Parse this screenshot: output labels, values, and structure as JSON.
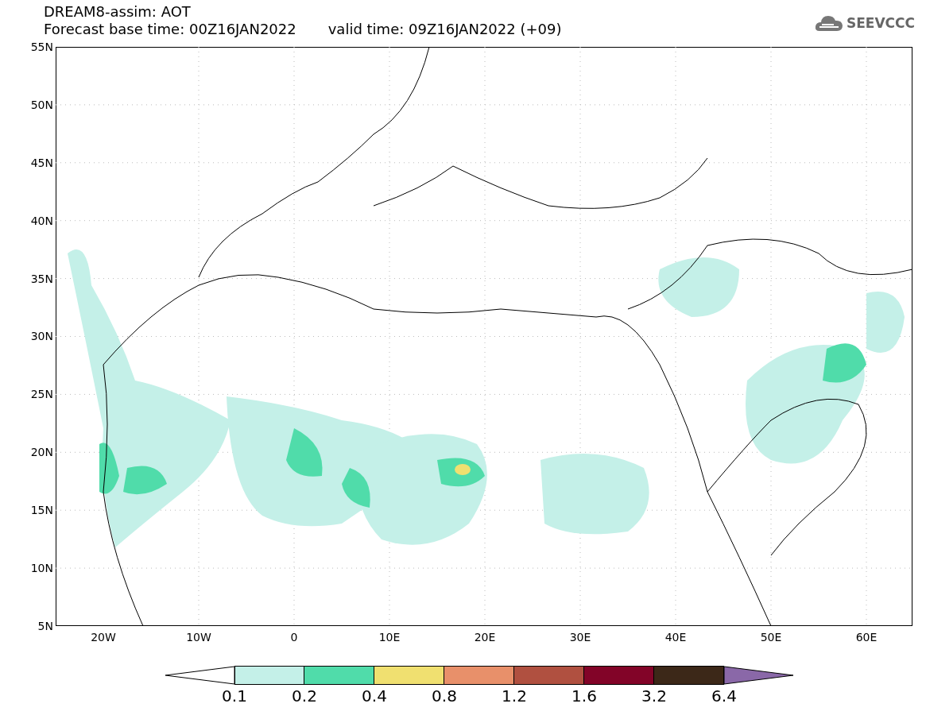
{
  "header": {
    "title": "DREAM8-assim: AOT",
    "base_time": "Forecast base time: 00Z16JAN2022",
    "valid_time": "valid time: 09Z16JAN2022 (+09)",
    "logo": "SEEVCCC"
  },
  "map": {
    "y_labels": [
      "55N",
      "50N",
      "45N",
      "40N",
      "35N",
      "30N",
      "25N",
      "20N",
      "15N",
      "10N",
      "5N"
    ],
    "x_labels": [
      "20W",
      "10W",
      "0",
      "10E",
      "20E",
      "30E",
      "40E",
      "50E",
      "60E"
    ]
  },
  "colorbar": {
    "bins": [
      {
        "kind": "under",
        "color": "#ffffff"
      },
      {
        "kind": "box",
        "color": "#c4f0e8"
      },
      {
        "kind": "box",
        "color": "#50dcaa"
      },
      {
        "kind": "box",
        "color": "#f0e070"
      },
      {
        "kind": "box",
        "color": "#e8906a"
      },
      {
        "kind": "box",
        "color": "#b05040"
      },
      {
        "kind": "box",
        "color": "#820428"
      },
      {
        "kind": "box",
        "color": "#3c2818"
      },
      {
        "kind": "over",
        "color": "#8a68a8"
      }
    ],
    "labels": [
      "0.1",
      "0.2",
      "0.4",
      "0.8",
      "1.2",
      "1.6",
      "3.2",
      "6.4"
    ]
  }
}
